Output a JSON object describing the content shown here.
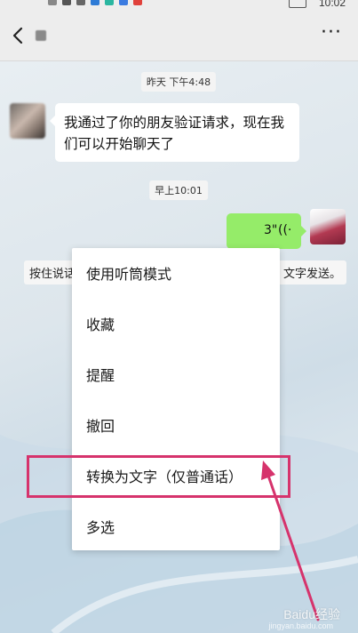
{
  "status_bar": {
    "time": "10:02"
  },
  "chat": {
    "timestamps": [
      "昨天 下午4:48",
      "早上10:01"
    ],
    "incoming_message": "我通过了你的朋友验证请求，现在我们可以开始聊天了",
    "voice_message": {
      "duration": "3\"",
      "icon": "voice-wave-icon"
    },
    "hint_left": "按住说话",
    "hint_right": "文字发送。"
  },
  "context_menu": {
    "items": [
      "使用听筒模式",
      "收藏",
      "提醒",
      "撤回",
      "转换为文字（仅普通话）",
      "多选"
    ],
    "highlighted_index": 4
  },
  "colors": {
    "accent": "#95ec69",
    "highlight": "#d6336c",
    "header_bg": "#ededed"
  },
  "watermark": {
    "brand": "Baidu经验",
    "domain": "jingyan.baidu.com"
  }
}
